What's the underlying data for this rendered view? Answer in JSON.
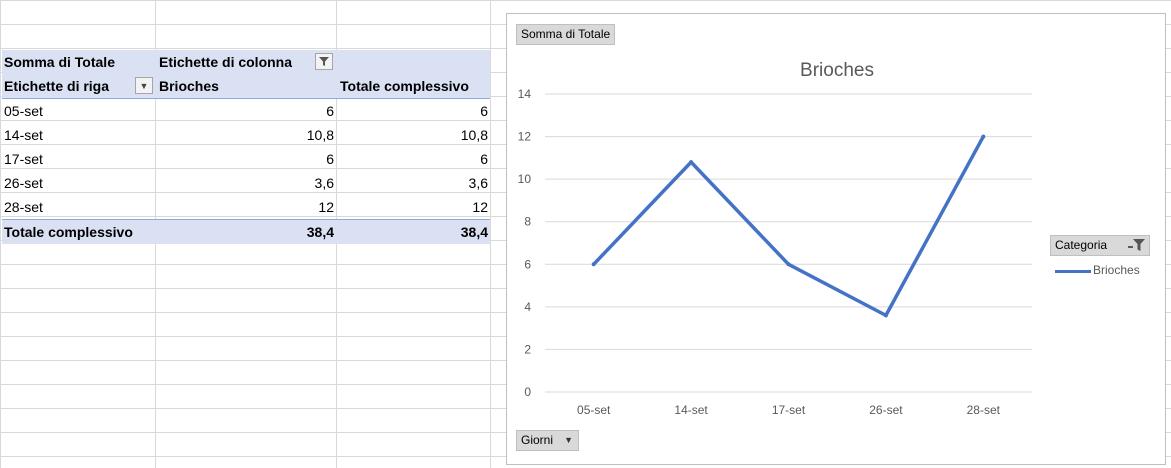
{
  "pivot": {
    "header1": {
      "values_label": "Somma di Totale",
      "columns_label": "Etichette di colonna"
    },
    "header2": {
      "rows_label": "Etichette di riga",
      "series_label": "Brioches",
      "grand_total_label": "Totale complessivo"
    },
    "rows": [
      {
        "label": "05-set",
        "brioches": "6",
        "total": "6"
      },
      {
        "label": "14-set",
        "brioches": "10,8",
        "total": "10,8"
      },
      {
        "label": "17-set",
        "brioches": "6",
        "total": "6"
      },
      {
        "label": "26-set",
        "brioches": "3,6",
        "total": "3,6"
      },
      {
        "label": "28-set",
        "brioches": "12",
        "total": "12"
      }
    ],
    "grand_total": {
      "label": "Totale complessivo",
      "brioches": "38,4",
      "total": "38,4"
    }
  },
  "chart": {
    "values_button": "Somma di Totale",
    "axis_button": "Giorni",
    "legend_button": "Categoria",
    "line_color": "#4472c4"
  },
  "chart_data": {
    "type": "line",
    "title": "Brioches",
    "categories": [
      "05-set",
      "14-set",
      "17-set",
      "26-set",
      "28-set"
    ],
    "series": [
      {
        "name": "Brioches",
        "values": [
          6,
          10.8,
          6,
          3.6,
          12
        ]
      }
    ],
    "ylim": [
      0,
      14
    ],
    "yticks": [
      0,
      2,
      4,
      6,
      8,
      10,
      12,
      14
    ],
    "grid": true,
    "legend": "right"
  }
}
